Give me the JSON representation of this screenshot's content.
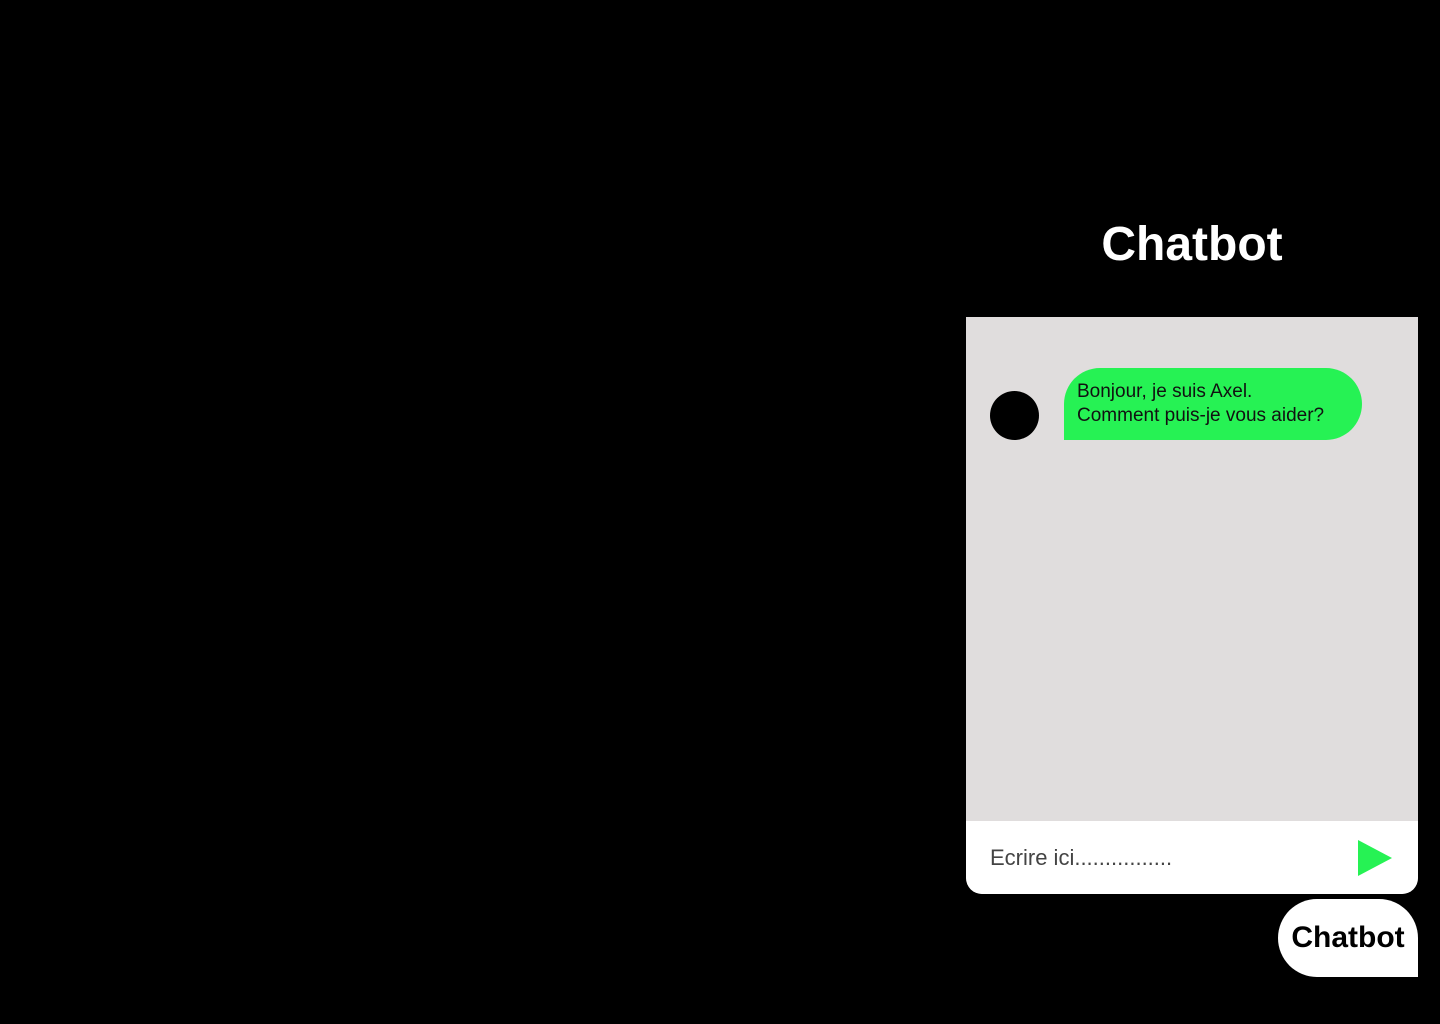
{
  "chat": {
    "title": "Chatbot",
    "messages": [
      {
        "sender": "bot",
        "lines": [
          "Bonjour, je suis Axel.",
          "Comment puis-je vous aider?"
        ]
      }
    ],
    "input_placeholder": "Ecrire ici................",
    "send_icon": "play-triangle-icon"
  },
  "launcher": {
    "label": "Chatbot"
  },
  "colors": {
    "background": "#000000",
    "chat_panel": "#e0dddd",
    "accent_green": "#26f254",
    "composer": "#ffffff"
  }
}
